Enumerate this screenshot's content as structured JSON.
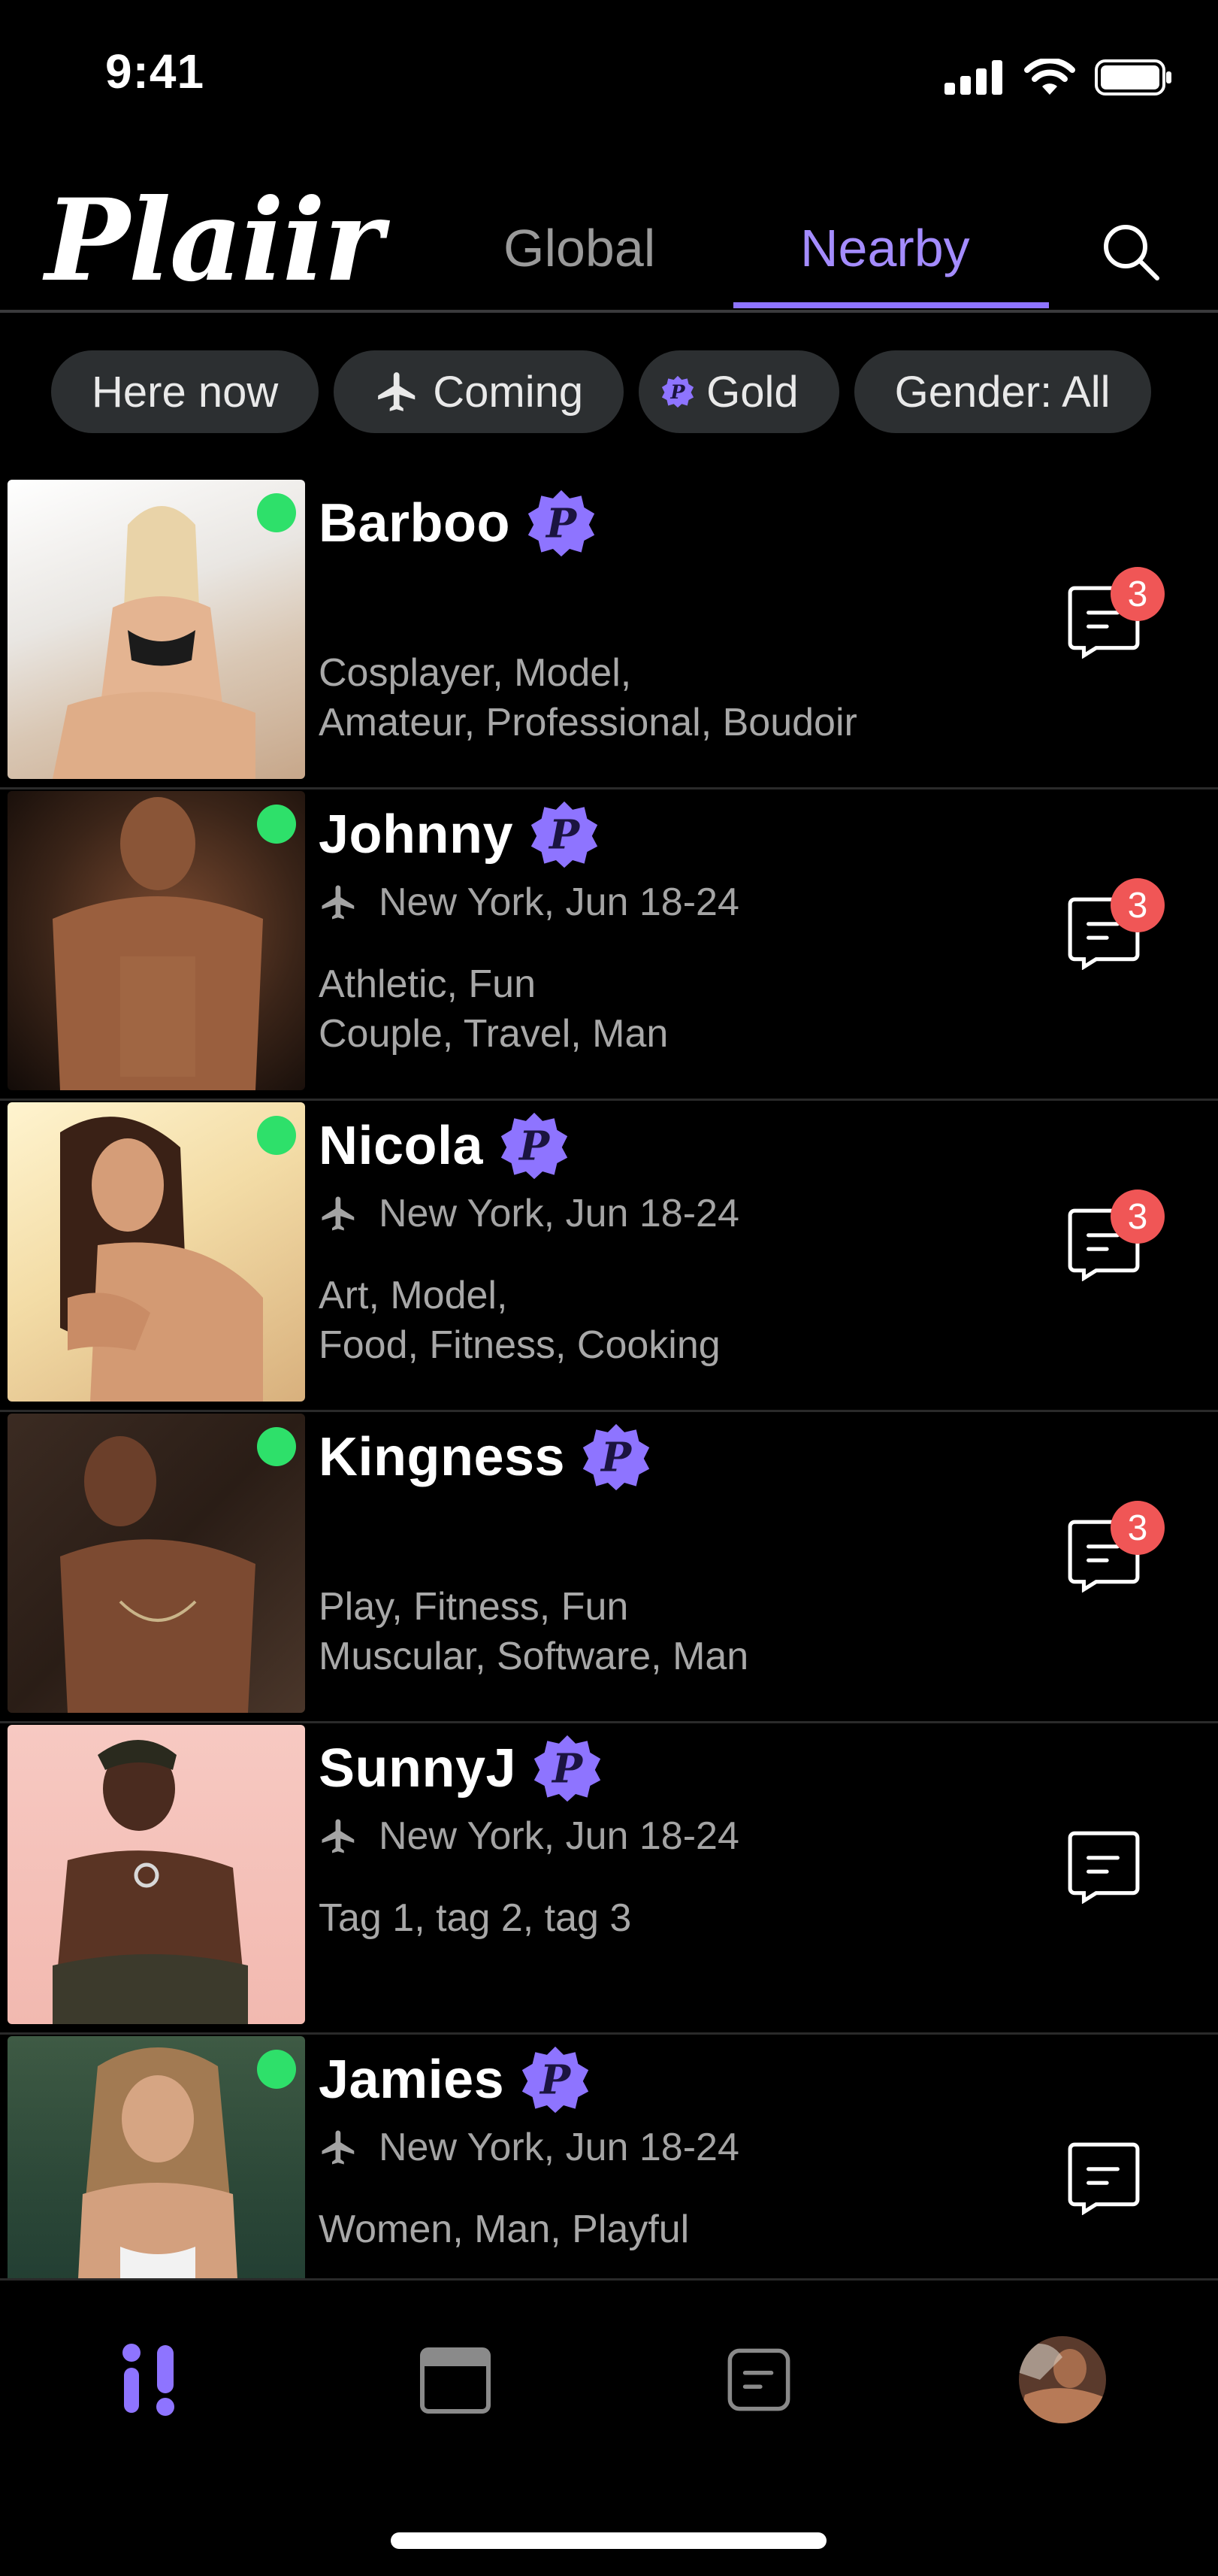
{
  "status_bar": {
    "time": "9:41"
  },
  "header": {
    "logo": "Plaiir",
    "tabs": [
      {
        "label": "Global"
      },
      {
        "label": "Nearby"
      }
    ],
    "active_tab": "Nearby"
  },
  "filters": [
    {
      "label": "Here now",
      "icon": ""
    },
    {
      "label": "Coming",
      "icon": "plane-icon"
    },
    {
      "label": "Gold",
      "icon": "plaiir-badge-icon"
    },
    {
      "label": "Gender: All",
      "icon": ""
    }
  ],
  "profiles": [
    {
      "name": "Barboo",
      "online": true,
      "trip": "",
      "tags_line1": "Cosplayer, Model,",
      "tags_line2": "Amateur, Professional, Boudoir",
      "unread": "3"
    },
    {
      "name": "Johnny",
      "online": true,
      "trip": "New York, Jun 18-24",
      "tags_line1": "Athletic, Fun",
      "tags_line2": "Couple, Travel, Man",
      "unread": "3"
    },
    {
      "name": "Nicola",
      "online": true,
      "trip": "New York, Jun 18-24",
      "tags_line1": "Art, Model,",
      "tags_line2": "Food, Fitness, Cooking",
      "unread": "3"
    },
    {
      "name": "Kingness",
      "online": true,
      "trip": "",
      "tags_line1": "Play, Fitness, Fun",
      "tags_line2": "Muscular, Software, Man",
      "unread": "3"
    },
    {
      "name": "SunnyJ",
      "online": false,
      "trip": "New York, Jun 18-24",
      "tags_line1": "",
      "tags_line2": "Tag 1, tag 2, tag 3",
      "unread": ""
    },
    {
      "name": "Jamies",
      "online": true,
      "trip": "New York, Jun 18-24",
      "tags_line1": "",
      "tags_line2": "Women, Man, Playful",
      "unread": ""
    }
  ],
  "colors": {
    "accent": "#a48cff",
    "online": "#2ee06a",
    "unread_badge": "#f05656",
    "chip_bg": "#2c2f31"
  },
  "bottom_nav": [
    {
      "icon": "discover-icon",
      "active": true
    },
    {
      "icon": "calendar-icon",
      "active": false
    },
    {
      "icon": "chat-icon",
      "active": false
    },
    {
      "icon": "profile-avatar",
      "active": false
    }
  ]
}
